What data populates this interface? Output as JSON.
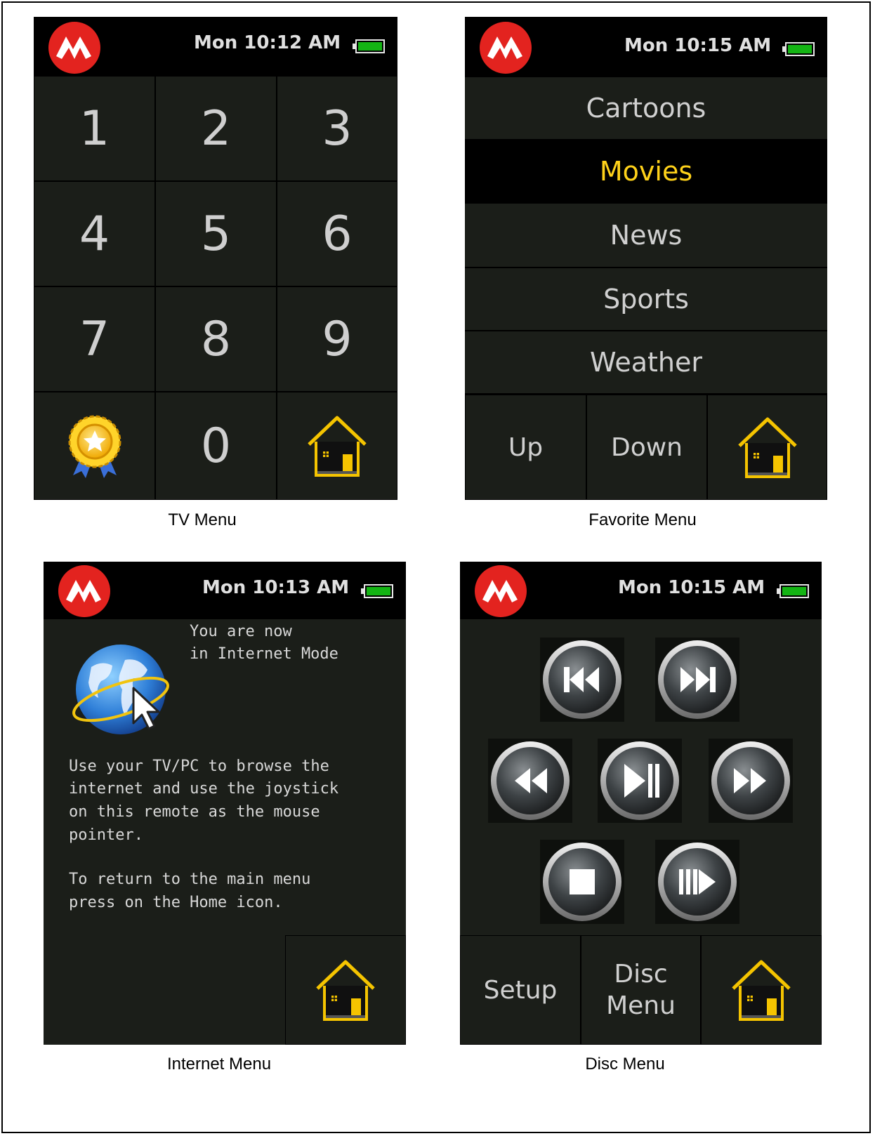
{
  "brand": {
    "logo_icon": "microchip-logo-icon",
    "logo_color": "#e3231f"
  },
  "colors": {
    "screen_bg": "#1b1e19",
    "status_bg": "#000000",
    "selected_text": "#ffd21a",
    "battery": "#14b414"
  },
  "tv_menu": {
    "time": "Mon 10:12 AM",
    "caption": "TV Menu",
    "keys": [
      "1",
      "2",
      "3",
      "4",
      "5",
      "6",
      "7",
      "8",
      "9"
    ],
    "zero": "0",
    "favorite_icon": "award-ribbon-icon",
    "home_icon": "home-icon"
  },
  "favorite_menu": {
    "time": "Mon 10:15 AM",
    "caption": "Favorite Menu",
    "items": [
      "Cartoons",
      "Movies",
      "News",
      "Sports",
      "Weather"
    ],
    "selected": "Movies",
    "up_label": "Up",
    "down_label": "Down",
    "home_icon": "home-icon"
  },
  "internet_menu": {
    "time": "Mon 10:13 AM",
    "caption": "Internet Menu",
    "mode_line1": "You are now",
    "mode_line2": "in Internet Mode",
    "body1_line1": "Use your TV/PC to browse the",
    "body1_line2": "internet and use the joystick",
    "body1_line3": "on this remote as the mouse",
    "body1_line4": "pointer.",
    "body2_line1": "To return to the main menu",
    "body2_line2": "press on the Home icon.",
    "globe_icon": "globe-cursor-icon",
    "home_icon": "home-icon"
  },
  "disc_menu": {
    "time": "Mon 10:15 AM",
    "caption": "Disc Menu",
    "setup_label": "Setup",
    "disc_menu_line1": "Disc",
    "disc_menu_line2": "Menu",
    "media_icons": [
      "skip-previous-icon",
      "skip-next-icon",
      "rewind-icon",
      "play-pause-icon",
      "fast-forward-icon",
      "stop-icon",
      "slow-play-icon"
    ],
    "home_icon": "home-icon"
  }
}
